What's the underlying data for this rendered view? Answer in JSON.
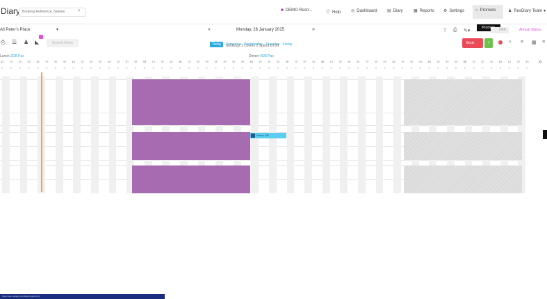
{
  "app": {
    "brand": "Diary",
    "search_placeholder": "Booking Reference, Names"
  },
  "nav": [
    {
      "label": "DEMO Restr...",
      "icon": "demo-icon",
      "glyph": "■"
    },
    {
      "label": "Help",
      "icon": "help-icon",
      "glyph": "ⓘ"
    },
    {
      "label": "Dashboard",
      "icon": "dashboard-icon",
      "glyph": "◎"
    },
    {
      "label": "Diary",
      "icon": "diary-icon",
      "glyph": "▤"
    },
    {
      "label": "Reports",
      "icon": "reports-icon",
      "glyph": "▦"
    },
    {
      "label": "Settings",
      "icon": "settings-icon",
      "glyph": "⚙"
    },
    {
      "label": "Promote",
      "icon": "megaphone-icon",
      "glyph": "⌂"
    },
    {
      "label": "ResDiary Team ▾",
      "icon": "user-icon",
      "glyph": "♟"
    }
  ],
  "tooltip": "Promote",
  "toolbar": {
    "place": "All Peter's Place",
    "ghost_button": "Search Notes",
    "date": "Monday, 26 January 2015",
    "quick_dates": [
      "Today",
      "Tomorrow",
      "Wednesday",
      "Thursday",
      "Friday"
    ],
    "summary": "Bookings 1 Covers 2 Spend £0.00",
    "off_label": "OFF",
    "annual_status": "Annual Status",
    "book_button": "Book"
  },
  "sessions": [
    {
      "label": "Lunch",
      "covers": "2/28 Pax"
    },
    {
      "label": "Dinner",
      "covers": "0/28 Pax"
    }
  ],
  "hours": [
    "11",
    "12",
    "13",
    "14",
    "15",
    "16",
    "17",
    "18",
    "19",
    "20",
    "21",
    "22",
    "23",
    "00",
    "01"
  ],
  "bookings": [
    {
      "label": "Pierre Gill"
    }
  ],
  "colors": {
    "block": "#a66bb1",
    "booking": "#5bcdf0",
    "now_line": "#f6a23b",
    "book_button": "#ea4b59",
    "accent": "#29a8e0"
  },
  "statusbar": "https://uat.resdiary.com/Diary/Index?id=1"
}
